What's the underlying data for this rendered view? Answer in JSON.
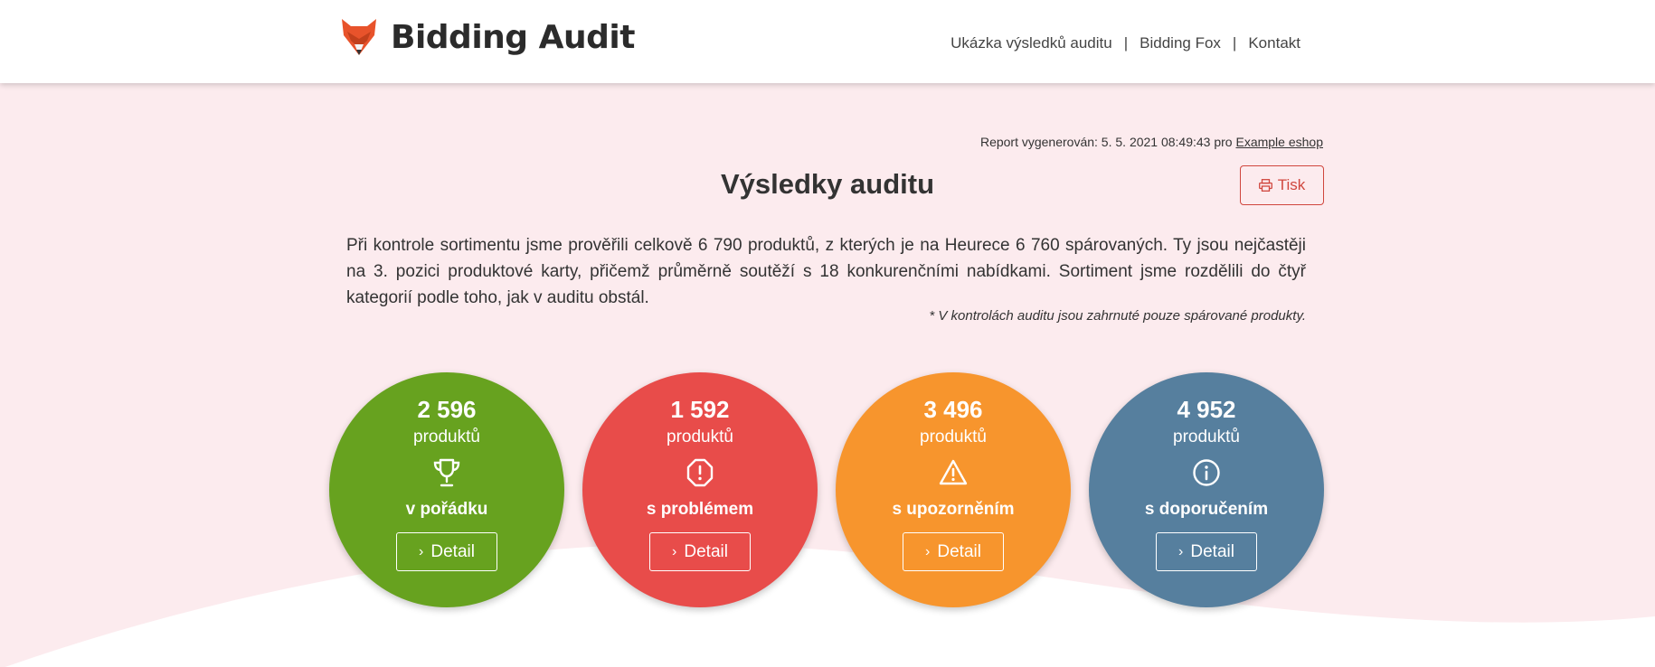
{
  "header": {
    "brand": "Bidding Audit",
    "nav": [
      {
        "label": "Ukázka výsledků auditu"
      },
      {
        "label": "Bidding Fox"
      },
      {
        "label": "Kontakt"
      }
    ],
    "separator": "|"
  },
  "report": {
    "generated_prefix": "Report vygenerován: 5. 5. 2021 08:49:43 pro",
    "eshop_link": "Example eshop",
    "title": "Výsledky auditu",
    "print_label": "Tisk",
    "intro": "Při kontrole sortimentu jsme prověřili celkově 6 790 produktů, z kterých je na Heurece 6 760 spárovaných. Ty jsou nejčastěji na 3. pozici produktové karty, přičemž průměrně soutěží s 18 konkurenčními nabídkami. Sortiment jsme rozdělili do čtyř kategorií podle toho, jak v auditu obstál.",
    "note": "* V kontrolách auditu jsou zahrnuté pouze spárované produkty."
  },
  "categories": [
    {
      "count": "2 596",
      "unit": "produktů",
      "label": "v pořádku",
      "button": "Detail",
      "color": "#67a21f",
      "icon": "trophy-icon"
    },
    {
      "count": "1 592",
      "unit": "produktů",
      "label": "s problémem",
      "button": "Detail",
      "color": "#e84c4a",
      "icon": "octagon-alert-icon"
    },
    {
      "count": "3 496",
      "unit": "produktů",
      "label": "s upozorněním",
      "button": "Detail",
      "color": "#f7952d",
      "icon": "warning-triangle-icon"
    },
    {
      "count": "4 952",
      "unit": "produktů",
      "label": "s doporučením",
      "button": "Detail",
      "color": "#567f9e",
      "icon": "info-icon"
    }
  ],
  "colors": {
    "hero_background": "#fcebee",
    "accent": "#d0463d",
    "logo_orange": "#e8532b"
  }
}
